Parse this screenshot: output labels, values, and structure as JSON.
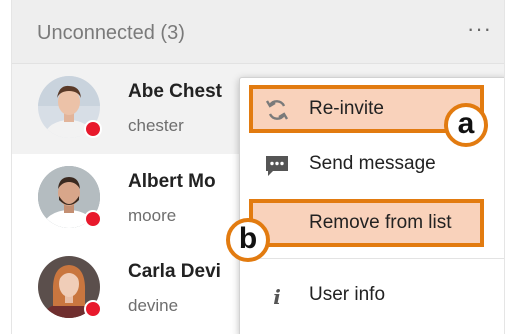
{
  "section": {
    "title": "Unconnected (3)",
    "more_icon": "more-horizontal-icon",
    "more_label": "···"
  },
  "contacts": [
    {
      "name": "Abe Chest",
      "username": "chester",
      "status_color": "#e8192c",
      "selected": true
    },
    {
      "name": "Albert Mo",
      "username": "moore",
      "status_color": "#e8192c",
      "selected": false
    },
    {
      "name": "Carla Devi",
      "username": "devine",
      "status_color": "#e8192c",
      "selected": false
    }
  ],
  "context_menu": {
    "items": [
      {
        "label": "Re-invite",
        "icon": "refresh-icon",
        "highlighted": true,
        "callout": "a"
      },
      {
        "label": "Send message",
        "icon": "chat-bubble-icon",
        "highlighted": false
      },
      {
        "label": "Remove from list",
        "icon": "",
        "highlighted": true,
        "callout": "b"
      },
      {
        "label": "User info",
        "icon": "info-icon",
        "highlighted": false
      }
    ]
  },
  "colors": {
    "highlight_fill": "#f9d2bb",
    "highlight_border": "#e27b10",
    "status_offline": "#e8192c",
    "header_bg": "#eeeeee"
  }
}
